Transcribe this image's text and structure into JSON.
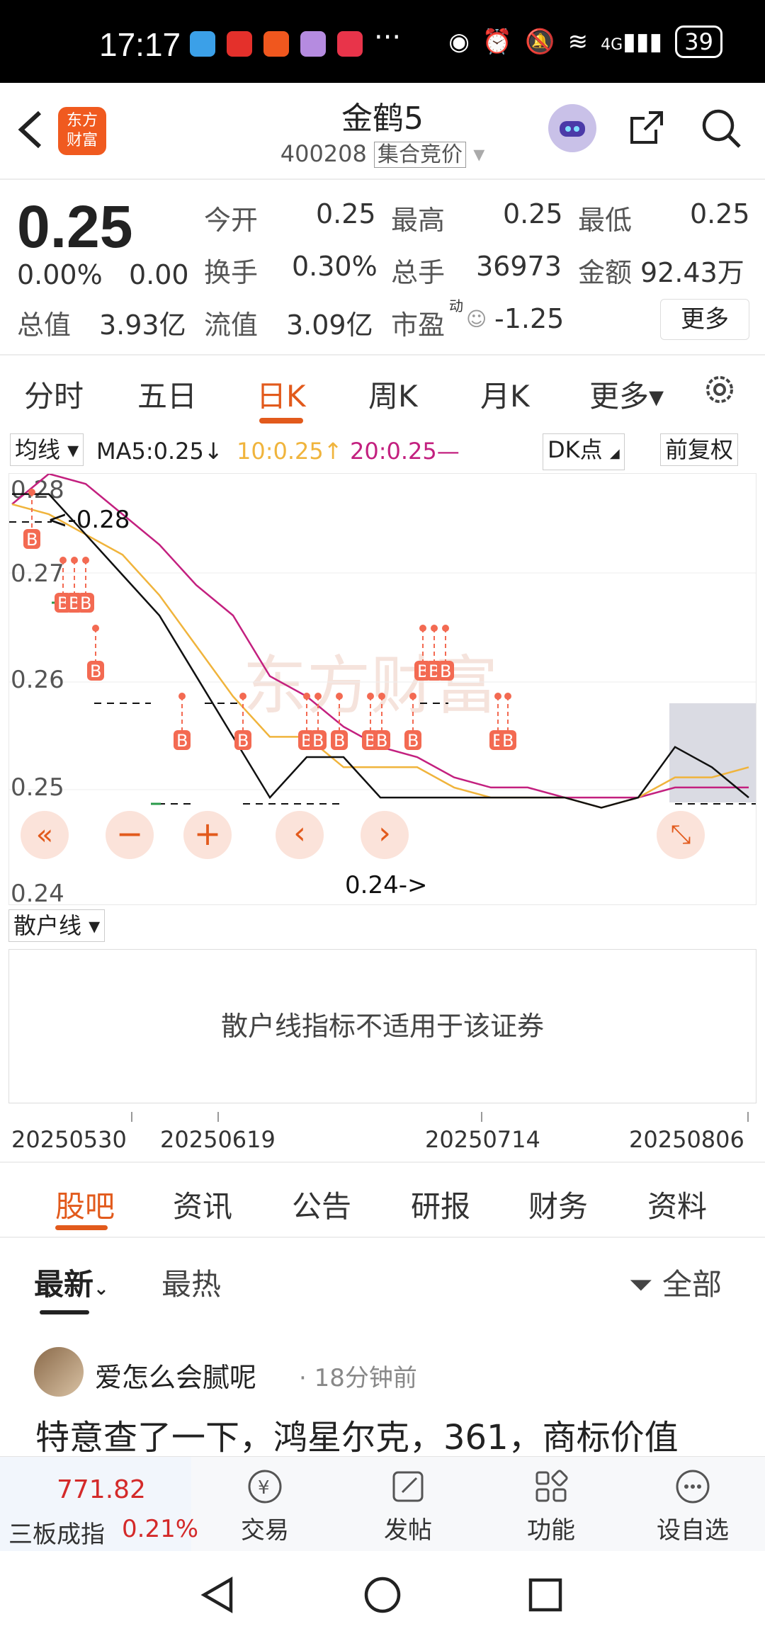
{
  "status_bar": {
    "time": "17:17",
    "battery": "39",
    "network": "4G"
  },
  "header": {
    "back_icon": "chevron-left-icon",
    "logo_text_1": "东方",
    "logo_text_2": "财富",
    "stock_name": "金鹤5",
    "stock_code": "400208",
    "auction_tag": "集合竞价"
  },
  "quote": {
    "price": "0.25",
    "change_pct": "0.00%",
    "change": "0.00",
    "open_label": "今开",
    "open": "0.25",
    "high_label": "最高",
    "high": "0.25",
    "low_label": "最低",
    "low": "0.25",
    "turnover_label": "换手",
    "turnover": "0.30%",
    "volume_label": "总手",
    "volume": "36973",
    "amount_label": "金额",
    "amount": "92.43万",
    "mktcap_label": "总值",
    "mktcap": "3.93亿",
    "float_label": "流值",
    "float_cap": "3.09亿",
    "pe_label": "市盈",
    "pe_sup": "动",
    "pe": "-1.25",
    "more_label": "更多"
  },
  "tabs": [
    "分时",
    "五日",
    "日K",
    "周K",
    "月K",
    "更多▾"
  ],
  "active_tab": "日K",
  "indicators": {
    "ma_select": "均线 ▾",
    "ma5": "MA5:0.25↓",
    "ma10": "10:0.25↑",
    "ma20": "20:0.25—",
    "dk_select": "DK点",
    "adjust_select": "前复权"
  },
  "chart": {
    "y_labels": [
      "0.28",
      "0.27",
      "0.26",
      "0.25",
      "0.24"
    ],
    "high_marker": "<-0.28",
    "low_marker": "0.24->",
    "buy_marker": "B",
    "watermark": "东方财富",
    "colors": {
      "price": "#111111",
      "ma10": "#f0b43c",
      "ma20": "#c3207f",
      "marker": "#f36a52"
    }
  },
  "chart_data": {
    "type": "line",
    "x": [
      "20250530",
      "20250619",
      "20250714",
      "20250806"
    ],
    "series": [
      {
        "name": "MA5",
        "values": [
          0.28,
          0.28,
          0.276,
          0.272,
          0.268,
          0.262,
          0.256,
          0.25,
          0.254,
          0.254,
          0.25,
          0.25,
          0.25,
          0.25,
          0.25,
          0.25,
          0.249,
          0.25,
          0.255,
          0.253,
          0.25
        ]
      },
      {
        "name": "10",
        "values": [
          0.279,
          0.278,
          0.276,
          0.274,
          0.27,
          0.265,
          0.26,
          0.256,
          0.256,
          0.253,
          0.253,
          0.253,
          0.251,
          0.25,
          0.25,
          0.25,
          0.249,
          0.25,
          0.252,
          0.252,
          0.253
        ]
      },
      {
        "name": "20",
        "values": [
          0.279,
          0.282,
          0.281,
          0.278,
          0.275,
          0.271,
          0.268,
          0.262,
          0.26,
          0.257,
          0.255,
          0.254,
          0.252,
          0.251,
          0.251,
          0.25,
          0.25,
          0.25,
          0.251,
          0.251,
          0.251
        ]
      }
    ],
    "ylim": [
      0.24,
      0.282
    ]
  },
  "controls": {
    "prev_icon": "double-left-icon",
    "zoom_out_icon": "minus-icon",
    "zoom_in_icon": "plus-icon",
    "scroll_left_icon": "chevron-left-icon",
    "scroll_right_icon": "chevron-right-icon",
    "fullscreen_icon": "expand-icon"
  },
  "sub_chart": {
    "select": "散户线 ▾",
    "message": "散户线指标不适用于该证券"
  },
  "dates": [
    "20250530",
    "20250619",
    "20250714",
    "20250806"
  ],
  "news_tabs": [
    "股吧",
    "资讯",
    "公告",
    "研报",
    "财务",
    "资料"
  ],
  "active_news_tab": "股吧",
  "sort": {
    "latest": "最新",
    "hot": "最热",
    "filter": "全部"
  },
  "post": {
    "user": "爱怎么会腻呢",
    "time": "18分钟前",
    "text": "特意查了一下，鸿星尔克，361，商标价值"
  },
  "bottom_bar": {
    "index_value": "771.82",
    "index_name": "三板成指",
    "index_change": "0.21%",
    "trade": "交易",
    "post": "发帖",
    "function": "功能",
    "watchlist": "设自选"
  },
  "nav": {
    "back": "back-triangle-icon",
    "home": "home-circle-icon",
    "recent": "recent-square-icon"
  }
}
